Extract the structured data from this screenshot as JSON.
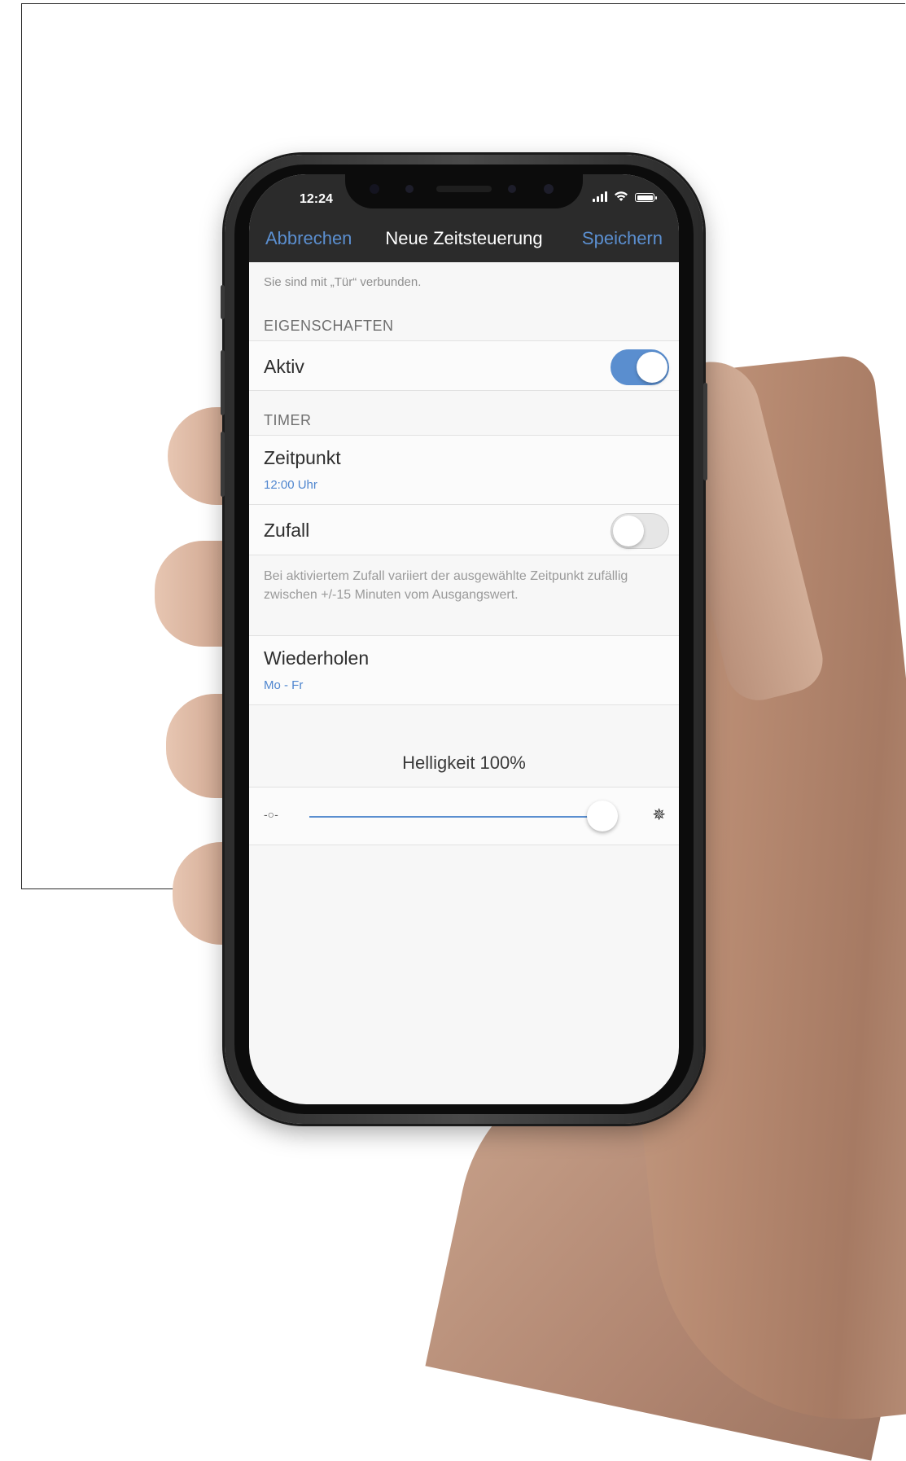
{
  "status": {
    "time": "12:24"
  },
  "nav": {
    "cancel": "Abbrechen",
    "title": "Neue Zeitsteuerung",
    "save": "Speichern"
  },
  "hint": "Sie sind mit „Tür“ verbunden.",
  "properties": {
    "header": "EIGENSCHAFTEN",
    "active_label": "Aktiv",
    "active_on": true
  },
  "timer": {
    "header": "TIMER",
    "time_label": "Zeitpunkt",
    "time_value": "12:00 Uhr",
    "random_label": "Zufall",
    "random_on": false,
    "random_note": "Bei aktiviertem Zufall variiert der ausgewählte Zeitpunkt zufällig zwischen +/-15 Minuten vom Ausgangswert.",
    "repeat_label": "Wiederholen",
    "repeat_value": "Mo - Fr"
  },
  "brightness": {
    "label": "Helligkeit 100%",
    "level_percent": 100
  },
  "icons": {
    "low": "sun-low-icon",
    "high": "sun-high-icon",
    "signal": "cellular-signal-icon",
    "wifi": "wifi-icon",
    "battery": "battery-icon"
  },
  "colors": {
    "accent": "#5a8ecf",
    "bar": "#2b2b2b",
    "background": "#f7f7f7"
  }
}
